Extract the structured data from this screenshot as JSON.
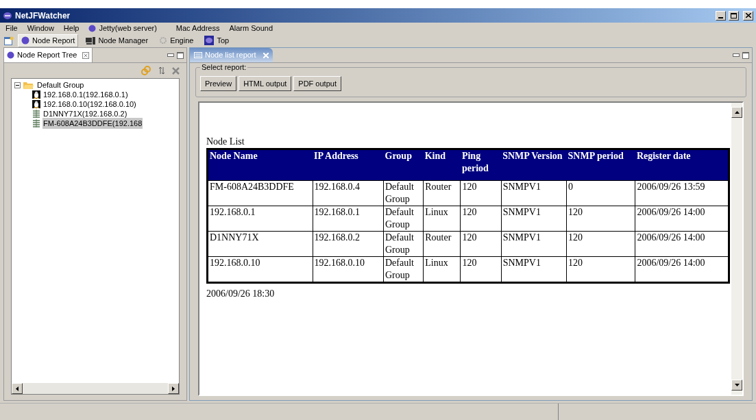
{
  "window": {
    "title": "NetJFWatcher"
  },
  "menu": [
    "File",
    "Window",
    "Help",
    "Jetty(web server)",
    "Mac Address",
    "Alarm Sound"
  ],
  "toolbar": [
    {
      "label": "Node Report",
      "kind": "report",
      "selected": true
    },
    {
      "label": "Node Manager",
      "kind": "manager",
      "selected": false
    },
    {
      "label": "Engine",
      "kind": "engine",
      "selected": false
    },
    {
      "label": "Top",
      "kind": "top",
      "selected": false
    }
  ],
  "left_panel": {
    "title": "Node Report Tree",
    "tree": [
      {
        "label": "Default Group",
        "expanded": true,
        "selected": false,
        "children": [
          {
            "label": "192.168.0.1(192.168.0.1)",
            "kind": "linux",
            "selected": false
          },
          {
            "label": "192.168.0.10(192.168.0.10)",
            "kind": "linux",
            "selected": false
          },
          {
            "label": "D1NNY71X(192.168.0.2)",
            "kind": "router",
            "selected": false
          },
          {
            "label": "FM-608A24B3DDFE(192.168",
            "kind": "router",
            "selected": true
          }
        ]
      }
    ]
  },
  "editor": {
    "tab": "Node list report",
    "group_label": "Select report:",
    "buttons": [
      "Preview",
      "HTML output",
      "PDF output"
    ],
    "report": {
      "title": "Node List",
      "columns": [
        "Node Name",
        "IP Address",
        "Group",
        "Kind",
        "Ping period",
        "SNMP Version",
        "SNMP period",
        "Register date"
      ],
      "rows": [
        [
          "FM-608A24B3DDFE",
          "192.168.0.4",
          "Default Group",
          "Router",
          "120",
          "SNMPV1",
          "0",
          "2006/09/26 13:59"
        ],
        [
          "192.168.0.1",
          "192.168.0.1",
          "Default Group",
          "Linux",
          "120",
          "SNMPV1",
          "120",
          "2006/09/26 14:00"
        ],
        [
          "D1NNY71X",
          "192.168.0.2",
          "Default Group",
          "Router",
          "120",
          "SNMPV1",
          "120",
          "2006/09/26 14:00"
        ],
        [
          "192.168.0.10",
          "192.168.0.10",
          "Default Group",
          "Linux",
          "120",
          "SNMPV1",
          "120",
          "2006/09/26 14:00"
        ]
      ],
      "footer": "2006/09/26 18:30"
    }
  }
}
